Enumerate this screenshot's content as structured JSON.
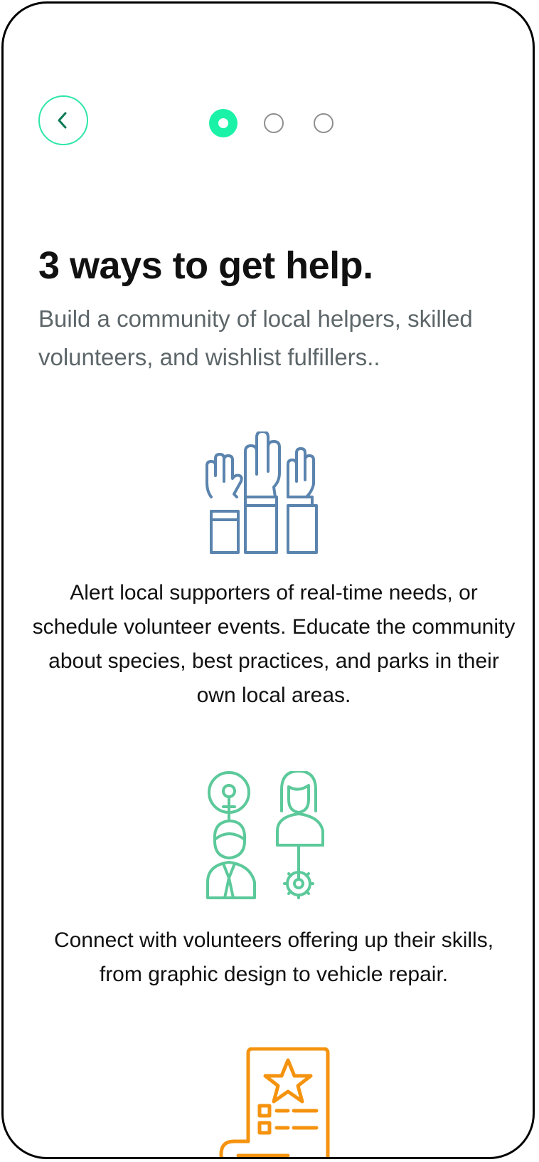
{
  "header": {
    "back_icon": "chevron-left-icon",
    "pager": {
      "total": 3,
      "current": 1
    }
  },
  "intro": {
    "title": "3 ways to get help.",
    "subtitle": "Build a community of local helpers, skilled volunteers, and wishlist fulfillers.."
  },
  "features": [
    {
      "icon": "raised-hands-icon",
      "color": "#5b84ae",
      "text": "Alert local supporters of real-time needs, or schedule volunteer events. Educate the community about species, best practices, and parks in their own local areas."
    },
    {
      "icon": "skilled-volunteers-icon",
      "color": "#5cc99a",
      "text": "Connect with volunteers offering up their skills, from graphic design to vehicle repair."
    },
    {
      "icon": "wishlist-scroll-icon",
      "color": "#f5930f",
      "text": ""
    }
  ],
  "colors": {
    "accent": "#19f2a7",
    "back_border": "#2ee6a8",
    "back_arrow": "#0d7a55",
    "title": "#111111",
    "subtitle": "#5d6669",
    "inactive_dot": "#8f8f8f"
  }
}
